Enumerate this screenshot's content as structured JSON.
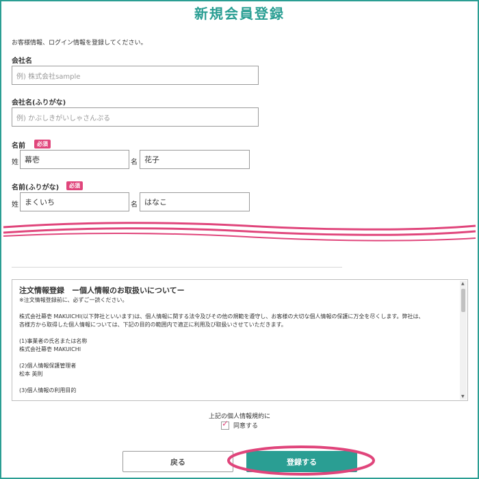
{
  "header": {
    "title": "新規会員登録"
  },
  "intro": "お客様情報、ログイン情報を登録してください。",
  "form": {
    "company": {
      "label": "会社名",
      "placeholder": "例) 株式会社sample"
    },
    "company_kana": {
      "label": "会社名(ふりがな)",
      "placeholder": "例) かぶしきがいしゃさんぷる"
    },
    "name": {
      "label": "名前",
      "badge": "必須",
      "last_label": "姓",
      "last_value": "幕壱",
      "first_label": "名",
      "first_value": "花子"
    },
    "name_kana": {
      "label": "名前(ふりがな)",
      "badge": "必須",
      "last_label": "姓",
      "last_value": "まくいち",
      "first_label": "名",
      "first_value": "はなこ"
    }
  },
  "policy": {
    "heading": "注文情報登録　ー個人情報のお取扱いについてー",
    "note": "※注文情報登録前に、必ずご一読ください。",
    "body1": "株式会社幕壱 MAKUICHI(以下弊社といいます)は、個人情報に関する法令及びその他の規範を遵守し、お客様の大切な個人情報の保護に万全を尽くします。弊社は、",
    "body2": "吝様方から取得した個人情報については、下記の目的の範囲内で適正に利用及び取扱いさせていただきます。",
    "s1_title": "(1)事業者の氏名または名称",
    "s1_value": "株式会社幕壱 MAKUICHI",
    "s2_title": "(2)個人情報保護管理者",
    "s2_value": "松本 英則",
    "s3_title": "(3)個人情報の利用目的"
  },
  "agreement": {
    "text": "上記の個人情報規約に",
    "checkbox_label": "同意する",
    "checked": true
  },
  "buttons": {
    "back": "戻る",
    "register": "登録する"
  },
  "colors": {
    "accent": "#2a9e93",
    "required": "#e0457b",
    "highlight": "#e0457b"
  }
}
